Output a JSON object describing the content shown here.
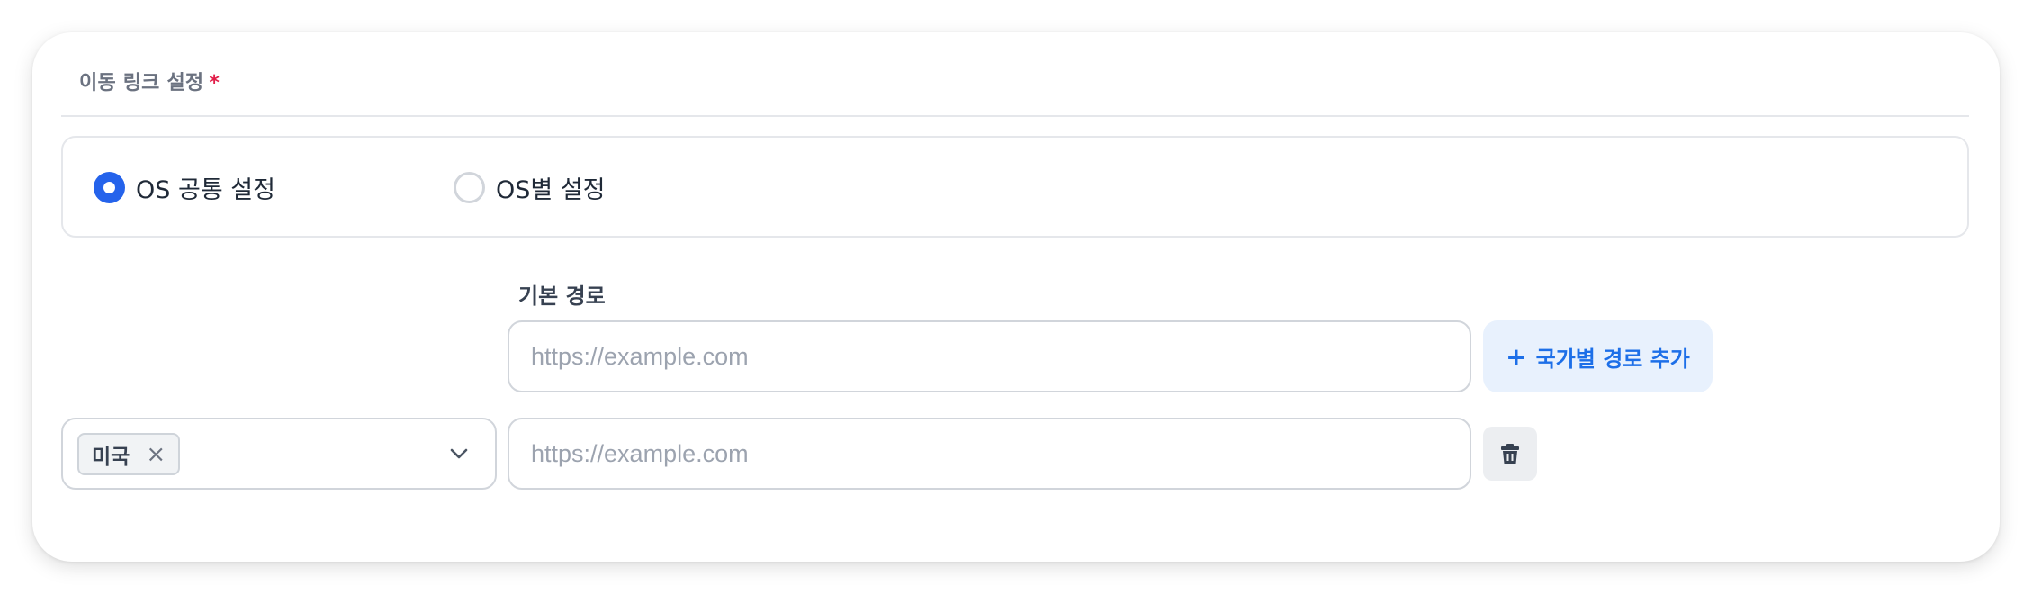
{
  "section": {
    "label": "이동 링크 설정",
    "required_mark": "*",
    "required_color": "#e11d48"
  },
  "os_mode": {
    "options": [
      {
        "label": "OS 공통 설정",
        "selected": true
      },
      {
        "label": "OS별 설정",
        "selected": false
      }
    ],
    "accent_color": "#2563eb"
  },
  "base_path": {
    "label": "기본 경로",
    "placeholder": "https://example.com",
    "value": ""
  },
  "add_country_button": {
    "icon": "plus-icon",
    "icon_text": "+",
    "label": "국가별 경로 추가",
    "color": "#1d6fe8",
    "background": "#e8f1fd"
  },
  "country_paths": [
    {
      "country_chip": {
        "label": "미국",
        "remove_icon": "close-icon",
        "remove_text": "×"
      },
      "dropdown_icon": "chevron-down-icon",
      "placeholder": "https://example.com",
      "value": "",
      "delete_icon": "trash-icon"
    }
  ]
}
